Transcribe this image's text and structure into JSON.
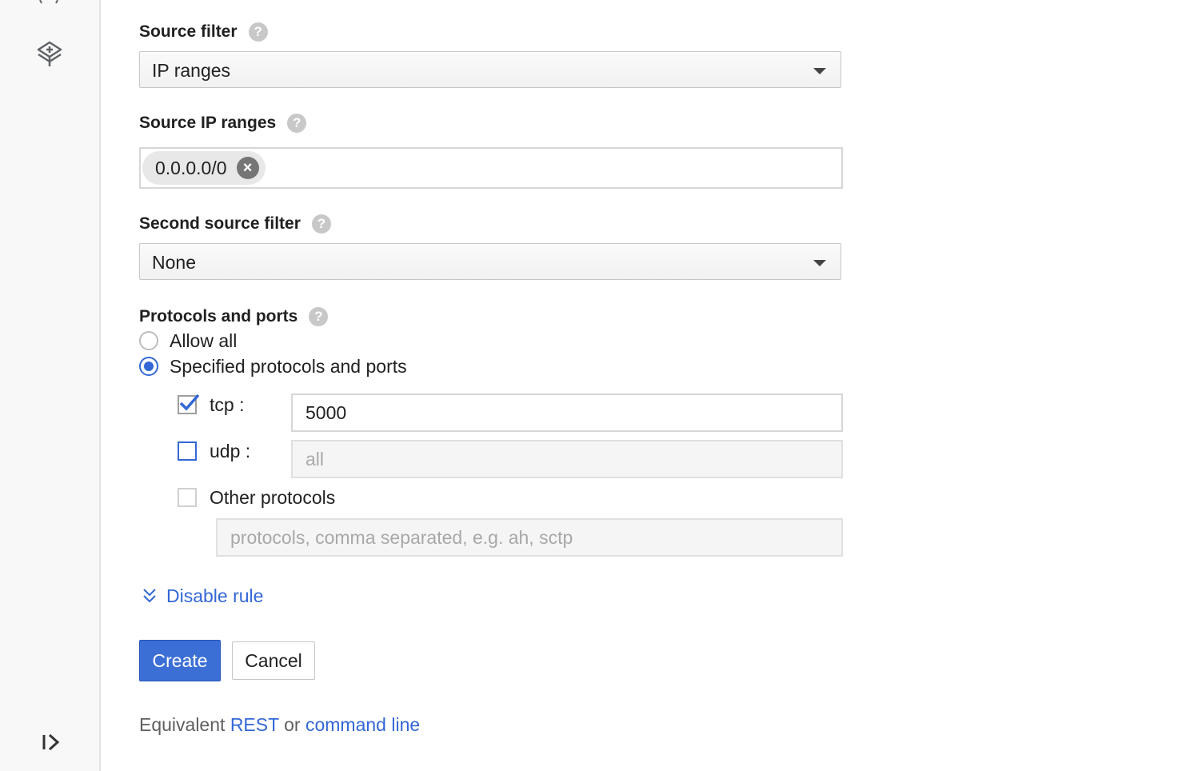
{
  "source_filter": {
    "label": "Source filter",
    "help": "?",
    "value": "IP ranges"
  },
  "source_ip_ranges": {
    "label": "Source IP ranges",
    "help": "?",
    "chips": [
      "0.0.0.0/0"
    ]
  },
  "second_source_filter": {
    "label": "Second source filter",
    "help": "?",
    "value": "None"
  },
  "protocols": {
    "label": "Protocols and ports",
    "help": "?",
    "options": [
      {
        "label": "Allow all",
        "selected": false
      },
      {
        "label": "Specified protocols and ports",
        "selected": true
      }
    ],
    "tcp": {
      "label": "tcp :",
      "checked": true,
      "value": "5000"
    },
    "udp": {
      "label": "udp :",
      "checked": false,
      "value": "all"
    },
    "other": {
      "label": "Other protocols",
      "checked": false,
      "placeholder": "protocols, comma separated, e.g. ah, sctp"
    }
  },
  "disable_rule": {
    "label": "Disable rule"
  },
  "buttons": {
    "create": "Create",
    "cancel": "Cancel"
  },
  "footer": {
    "prefix": "Equivalent",
    "rest": "REST",
    "or": "or",
    "command_line": "command line"
  },
  "colors": {
    "accent": "#3367d6",
    "primary_button": "#3b6fd6"
  }
}
